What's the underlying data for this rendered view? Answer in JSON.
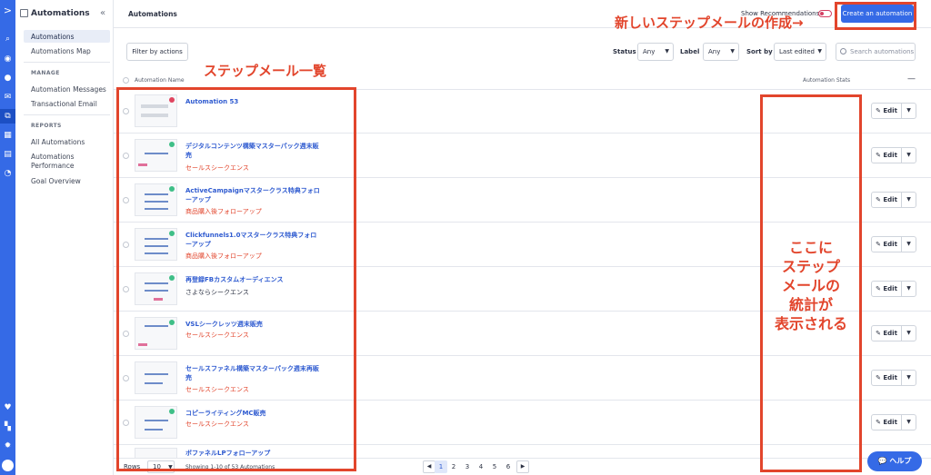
{
  "rail": {
    "icons": [
      "logo-icon",
      "search-icon",
      "location-icon",
      "contacts-icon",
      "mail-icon",
      "automations-icon",
      "pipelines-icon",
      "lists-icon",
      "reports-icon",
      "favorites-icon",
      "apps-icon",
      "settings-icon"
    ]
  },
  "sidebar": {
    "title": "Automations",
    "items_main": [
      "Automations",
      "Automations Map"
    ],
    "manage_header": "MANAGE",
    "manage_items": [
      "Automation Messages",
      "Transactional Email"
    ],
    "reports_header": "REPORTS",
    "reports_items": [
      "All Automations",
      "Automations Performance",
      "Goal Overview"
    ]
  },
  "topbar": {
    "title": "Automations",
    "show_recommendations": "Show Recommendations",
    "create_button": "Create an automation"
  },
  "filters": {
    "filter_button": "Filter by actions",
    "status_label": "Status",
    "status_value": "Any",
    "label_label": "Label",
    "label_value": "Any",
    "sort_label": "Sort by",
    "sort_value": "Last edited",
    "search_placeholder": "Search automations"
  },
  "table": {
    "col_name": "Automation Name",
    "col_stats": "Automation Stats",
    "edit_label": "Edit",
    "rows": [
      {
        "name": "Automation 53",
        "sub": "",
        "sub_color": "#e2452c"
      },
      {
        "name": "デジタルコンテンツ構築マスターパック週末販売",
        "sub": "セールスシークエンス",
        "sub_color": "#e2452c"
      },
      {
        "name": "ActiveCampaignマスタークラス特典フォローアップ",
        "sub": "商品購入後フォローアップ",
        "sub_color": "#e2452c"
      },
      {
        "name": "Clickfunnels1.0マスタークラス特典フォローアップ",
        "sub": "商品購入後フォローアップ",
        "sub_color": "#e2452c"
      },
      {
        "name": "再登録FBカスタムオーディエンス",
        "sub": "さよならシークエンス",
        "sub_color": "#2d3344"
      },
      {
        "name": "VSLシークレッツ週末販売",
        "sub": "セールスシークエンス",
        "sub_color": "#e2452c"
      },
      {
        "name": "セールスファネル構築マスターパック週末再販売",
        "sub": "セールスシークエンス",
        "sub_color": "#e2452c"
      },
      {
        "name": "コピーライティングMC販売",
        "sub": "セールスシークエンス",
        "sub_color": "#e2452c"
      },
      {
        "name": "ボファネルLPフォローアップ",
        "sub": "",
        "sub_color": "#e2452c"
      }
    ]
  },
  "footer": {
    "rows_label": "Rows",
    "rows_value": "10",
    "showing": "Showing 1-10 of 53 Automations",
    "pages": [
      "1",
      "2",
      "3",
      "4",
      "5",
      "6"
    ],
    "prev": "◀",
    "next": "▶"
  },
  "help": "ヘルプ",
  "annotations": {
    "create_note": "新しいステップメールの作成→",
    "list_note": "ステップメール一覧",
    "stats_note_lines": [
      "ここに",
      "ステップ",
      "メールの",
      "統計が",
      "表示される"
    ]
  },
  "colors": {
    "accent": "#356ae6",
    "annotation": "#e2452c",
    "link": "#2f5bd0"
  }
}
